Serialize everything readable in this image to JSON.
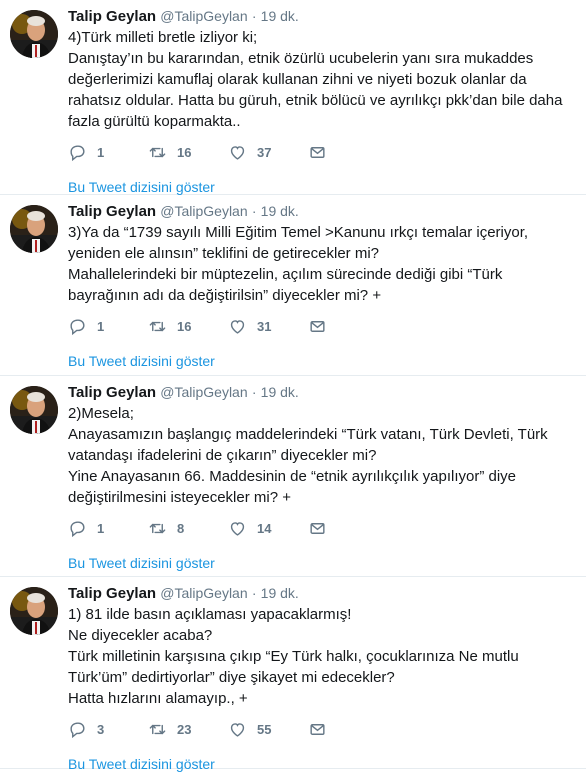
{
  "tweets": [
    {
      "name": "Talip Geylan",
      "handle": "@TalipGeylan",
      "dot": "·",
      "time": "19 dk.",
      "lines": [
        "4)Türk milleti bretle izliyor ki;",
        "Danıştay’ın bu kararından, etnik özürlü ucubelerin yanı sıra mukaddes değerlerimizi kamuflaj olarak kullanan zihni ve niyeti bozuk olanlar da rahatsız oldular. Hatta bu güruh, etnik bölücü ve ayrılıkçı pkk’dan bile daha fazla gürültü koparmakta.."
      ],
      "replies": "1",
      "retweets": "16",
      "likes": "37",
      "thread_link": "Bu Tweet dizisini göster"
    },
    {
      "name": "Talip Geylan",
      "handle": "@TalipGeylan",
      "dot": "·",
      "time": "19 dk.",
      "lines": [
        "3)Ya da “1739 sayılı Milli Eğitim Temel >Kanunu ırkçı temalar içeriyor, yeniden ele alınsın” teklifini de getirecekler mi?",
        "Mahallelerindeki bir müptezelin, açılım sürecinde dediği gibi “Türk bayrağının adı da değiştirilsin” diyecekler mi? +"
      ],
      "replies": "1",
      "retweets": "16",
      "likes": "31",
      "thread_link": "Bu Tweet dizisini göster"
    },
    {
      "name": "Talip Geylan",
      "handle": "@TalipGeylan",
      "dot": "·",
      "time": "19 dk.",
      "lines": [
        "2)Mesela;",
        "Anayasamızın başlangıç maddelerindeki “Türk vatanı, Türk Devleti, Türk vatandaşı ifadelerini de çıkarın” diyecekler mi?",
        "Yine Anayasanın 66. Maddesinin de “etnik ayrılıkçılık yapılıyor” diye değiştirilmesini isteyecekler mi? +"
      ],
      "replies": "1",
      "retweets": "8",
      "likes": "14",
      "thread_link": "Bu Tweet dizisini göster"
    },
    {
      "name": "Talip Geylan",
      "handle": "@TalipGeylan",
      "dot": "·",
      "time": "19 dk.",
      "lines": [
        "1) 81 ilde basın açıklaması yapacaklarmış!",
        "Ne diyecekler acaba?",
        "Türk milletinin karşısına çıkıp “Ey Türk halkı, çocuklarınıza Ne mutlu Türk’üm” dedirtiyorlar” diye şikayet mi edecekler?",
        "Hatta hızlarını alamayıp., +"
      ],
      "replies": "3",
      "retweets": "23",
      "likes": "55",
      "thread_link": "Bu Tweet dizisini göster"
    }
  ]
}
